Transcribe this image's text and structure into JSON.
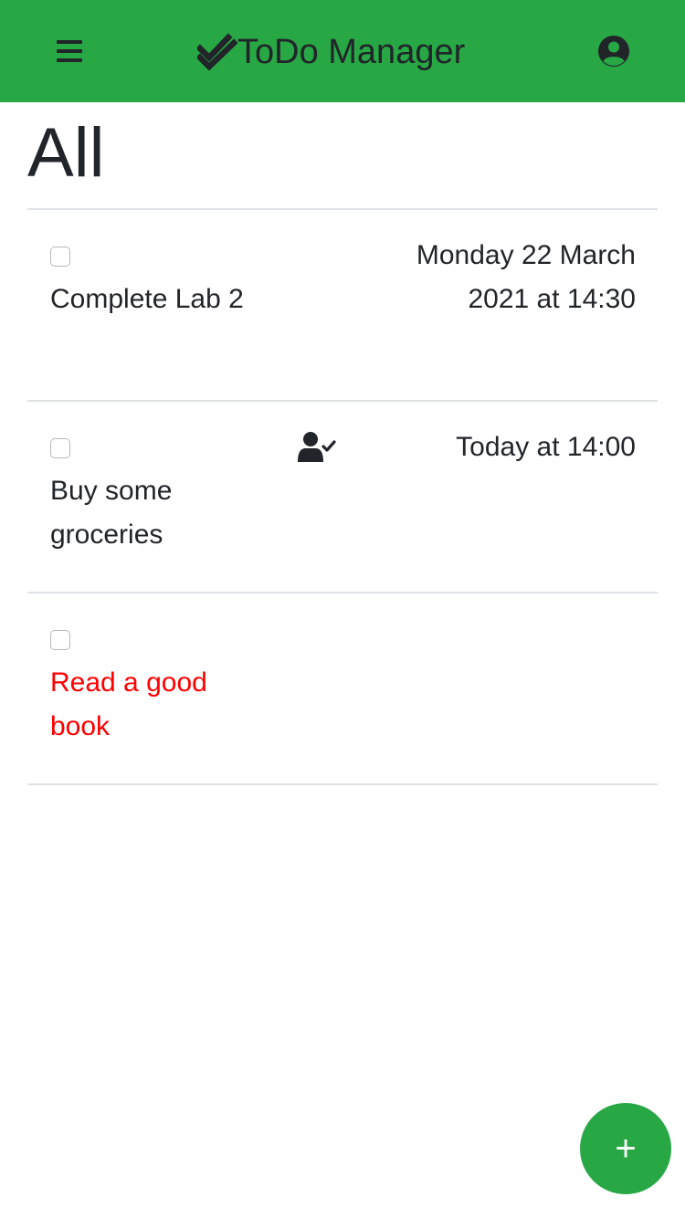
{
  "navbar": {
    "brand_title": "ToDo Manager",
    "menu_icon": "hamburger-menu-icon",
    "brand_icon": "check-double-icon",
    "user_icon": "user-circle-icon",
    "background_color": "#28a745"
  },
  "filter": {
    "title": "All"
  },
  "tasks": [
    {
      "description": "Complete Lab 2",
      "deadline": "Monday 22 March 2021 at 14:30",
      "important": false,
      "shared": false,
      "completed": false
    },
    {
      "description": "Buy some groceries",
      "deadline": "Today at 14:00",
      "important": false,
      "shared": true,
      "shared_icon": "user-check-icon",
      "completed": false
    },
    {
      "description": "Read a good book",
      "deadline": "",
      "important": true,
      "important_color": "#ff0000",
      "shared": false,
      "completed": false
    }
  ],
  "add_button": {
    "label": "+",
    "icon": "plus-icon",
    "color": "#28a745"
  }
}
